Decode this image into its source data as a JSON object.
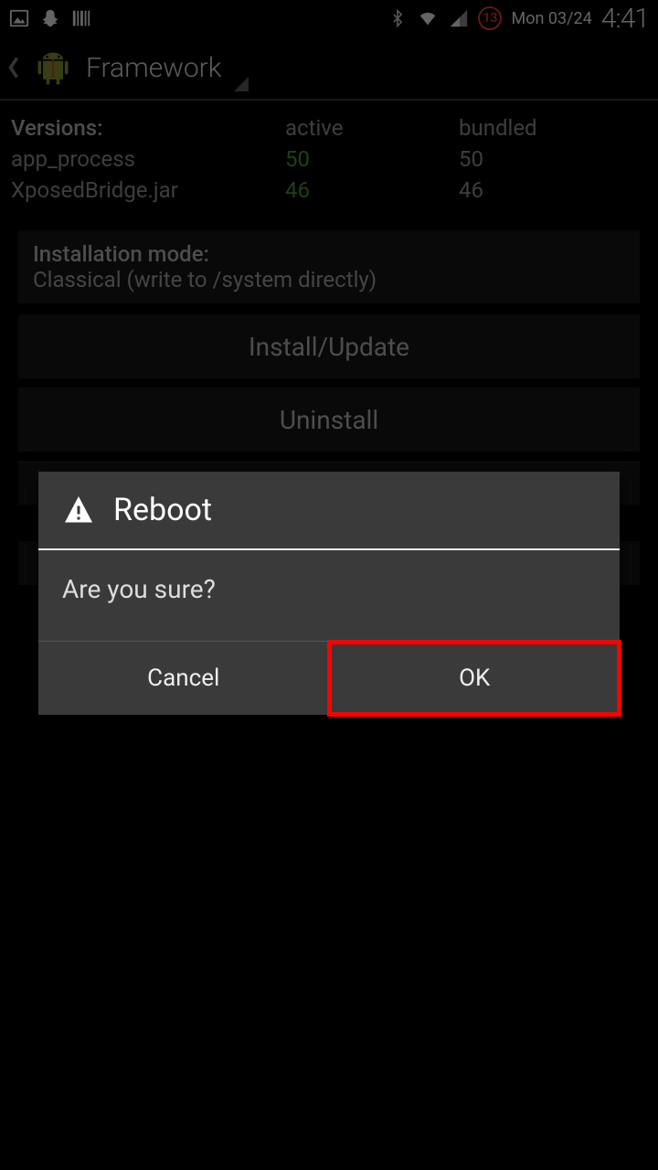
{
  "status": {
    "badge_count": "13",
    "date": "Mon 03/24",
    "time": "4:41"
  },
  "actionbar": {
    "title": "Framework"
  },
  "versions": {
    "header_label": "Versions:",
    "col_active": "active",
    "col_bundled": "bundled",
    "rows": [
      {
        "name": "app_process",
        "active": "50",
        "bundled": "50"
      },
      {
        "name": "XposedBridge.jar",
        "active": "46",
        "bundled": "46"
      }
    ]
  },
  "install_mode": {
    "label": "Installation mode:",
    "value": "Classical (write to /system directly)"
  },
  "buttons": {
    "install": "Install/Update",
    "uninstall": "Uninstall"
  },
  "dialog": {
    "title": "Reboot",
    "message": "Are you sure?",
    "cancel": "Cancel",
    "ok": "OK"
  }
}
